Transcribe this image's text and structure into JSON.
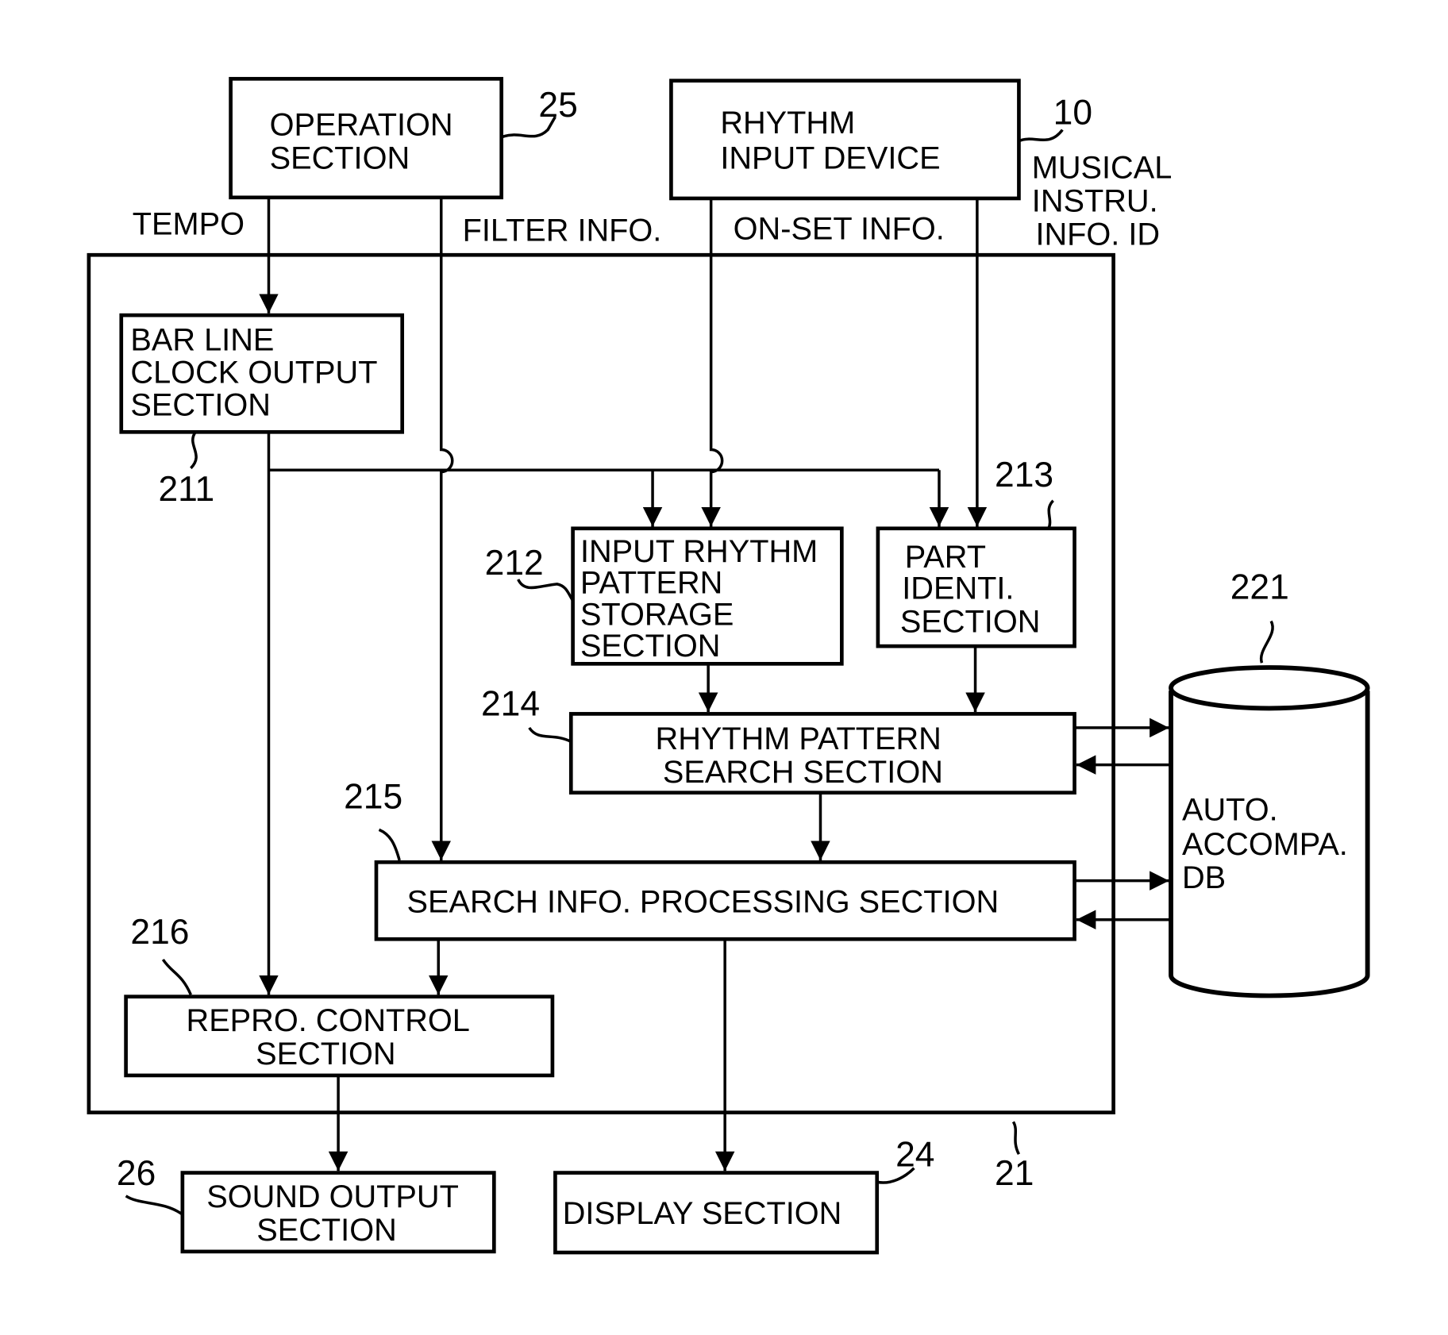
{
  "diagram": {
    "operation_section": {
      "lines": [
        "OPERATION",
        "SECTION"
      ],
      "ref": "25"
    },
    "rhythm_input_device": {
      "lines": [
        "RHYTHM",
        "INPUT DEVICE"
      ],
      "ref": "10"
    },
    "musical_instru_info_id": {
      "lines": [
        "MUSICAL",
        "INSTRU.",
        "INFO. ID"
      ]
    },
    "signals": {
      "tempo": "TEMPO",
      "filter_info": "FILTER INFO.",
      "onset_info": "ON-SET INFO."
    },
    "bar_line_clock": {
      "lines": [
        "BAR LINE",
        "CLOCK OUTPUT",
        "SECTION"
      ],
      "ref": "211"
    },
    "input_rhythm_pattern_storage": {
      "lines": [
        "INPUT RHYTHM",
        "PATTERN",
        "STORAGE",
        "SECTION"
      ],
      "ref": "212"
    },
    "part_identi": {
      "lines": [
        "PART",
        "IDENTI.",
        "SECTION"
      ],
      "ref": "213"
    },
    "rhythm_pattern_search": {
      "lines": [
        "RHYTHM PATTERN",
        "SEARCH SECTION"
      ],
      "ref": "214"
    },
    "search_info_processing": {
      "lines": [
        "SEARCH INFO. PROCESSING SECTION"
      ],
      "ref": "215"
    },
    "repro_control": {
      "lines": [
        "REPRO. CONTROL",
        "SECTION"
      ],
      "ref": "216"
    },
    "auto_accompa_db": {
      "lines": [
        "AUTO.",
        "ACCOMPA.",
        "DB"
      ],
      "ref": "221"
    },
    "sound_output": {
      "lines": [
        "SOUND OUTPUT",
        "SECTION"
      ],
      "ref": "26"
    },
    "display_section": {
      "lines": [
        "DISPLAY SECTION"
      ],
      "ref": "24"
    },
    "controller": {
      "ref": "21"
    }
  }
}
